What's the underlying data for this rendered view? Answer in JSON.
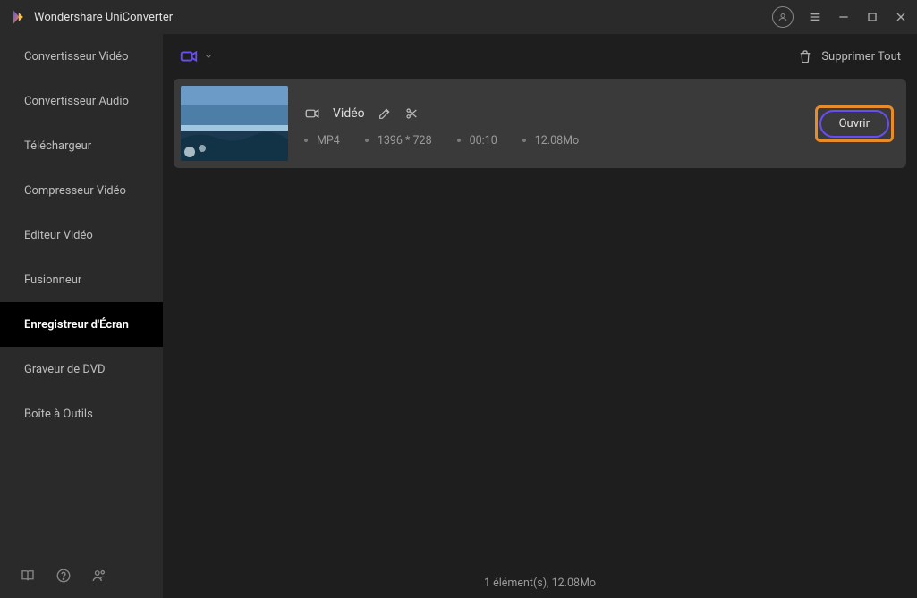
{
  "app": {
    "title": "Wondershare UniConverter"
  },
  "sidebar": {
    "items": [
      {
        "label": "Convertisseur Vidéo"
      },
      {
        "label": "Convertisseur Audio"
      },
      {
        "label": "Téléchargeur"
      },
      {
        "label": "Compresseur Vidéo"
      },
      {
        "label": "Editeur Vidéo"
      },
      {
        "label": "Fusionneur"
      },
      {
        "label": "Enregistreur d'Écran"
      },
      {
        "label": "Graveur de DVD"
      },
      {
        "label": "Boîte à Outils"
      }
    ],
    "active_index": 6
  },
  "toolbar": {
    "delete_all_label": "Supprimer Tout"
  },
  "file": {
    "type_label": "Vidéo",
    "format": "MP4",
    "resolution": "1396 * 728",
    "duration": "00:10",
    "size": "12.08Mo",
    "open_label": "Ouvrir"
  },
  "status": {
    "text": "1 élément(s), 12.08Mo"
  },
  "colors": {
    "accent": "#6a4df0",
    "highlight_box": "#e88c2a"
  }
}
